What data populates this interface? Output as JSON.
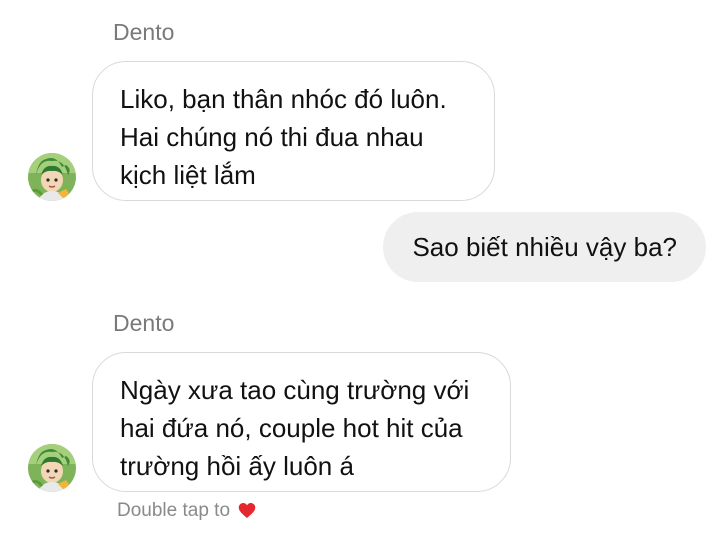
{
  "thread": {
    "messages": [
      {
        "sender": "Dento",
        "lines": [
          "Liko, bạn thân nhóc đó luôn.",
          "Hai chúng nó thi đua nhau",
          "kịch liệt lắm"
        ]
      },
      {
        "outgoing_text": "Sao biết nhiều vậy ba?"
      },
      {
        "sender": "Dento",
        "lines": [
          "Ngày xưa tao cùng trường với",
          "hai đứa nó, couple hot hit của",
          "trường hồi ấy luôn á"
        ]
      }
    ],
    "double_tap_hint": "Double tap to",
    "hint_icon": "heart-icon",
    "heart_color": "#e5282f"
  }
}
